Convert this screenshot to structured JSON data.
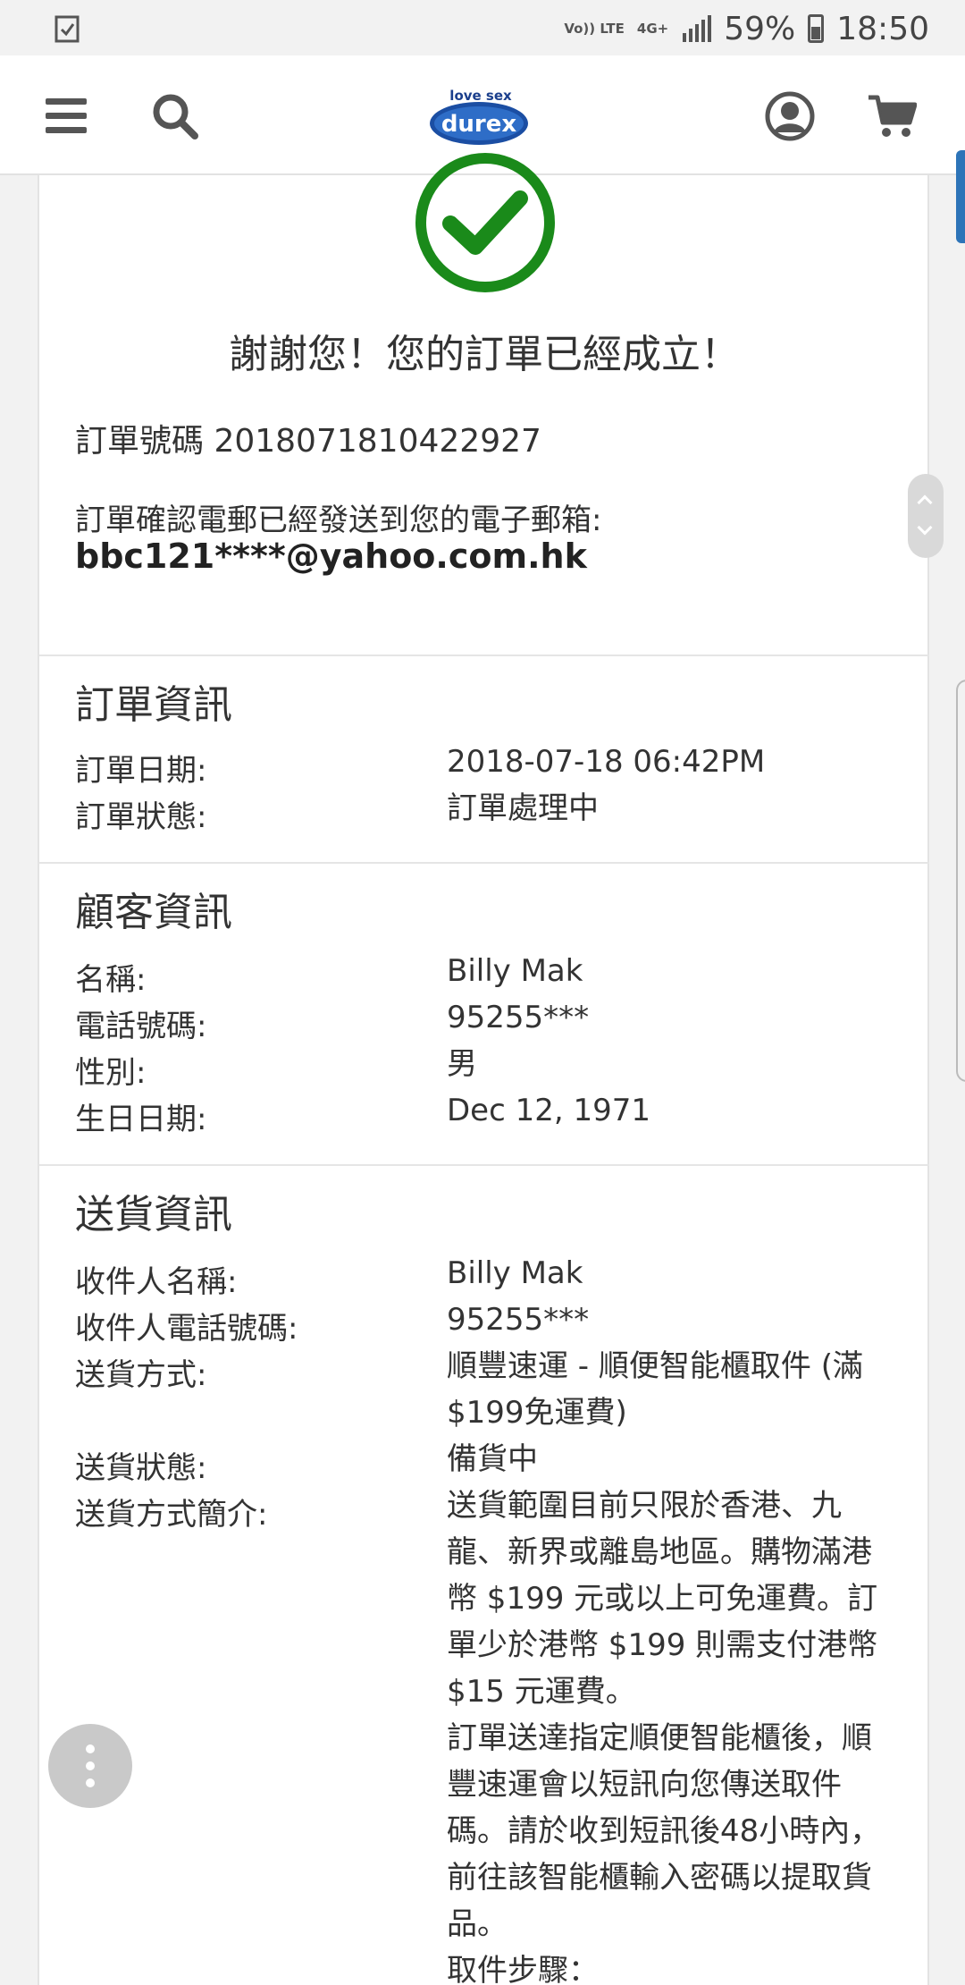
{
  "status_bar": {
    "left_icon": "clipboard-check-icon",
    "network": "Vo)) LTE",
    "network_type": "4G+",
    "battery": "59%",
    "time": "18:50"
  },
  "navbar": {
    "menu_icon": "hamburger-menu-icon",
    "search_icon": "search-icon",
    "logo_tagline": "love sex",
    "logo_brand": "durex",
    "account_icon": "user-account-icon",
    "cart_icon": "shopping-cart-icon"
  },
  "confirmation": {
    "icon": "check-circle-icon",
    "title": "謝謝您！您的訂單已經成立！",
    "order_number_text": "訂單號碼 2018071810422927",
    "email_sent_text": "訂單確認電郵已經發送到您的電子郵箱:",
    "email": "bbc121****@yahoo.com.hk"
  },
  "order_info": {
    "title": "訂單資訊",
    "rows": [
      {
        "label": "訂單日期:",
        "value": "2018-07-18 06:42PM"
      },
      {
        "label": "訂單狀態:",
        "value": "訂單處理中"
      }
    ]
  },
  "customer_info": {
    "title": "顧客資訊",
    "rows": [
      {
        "label": "名稱:",
        "value": "Billy Mak"
      },
      {
        "label": "電話號碼:",
        "value": "95255***"
      },
      {
        "label": "性別:",
        "value": "男"
      },
      {
        "label": "生日日期:",
        "value": "Dec 12, 1971"
      }
    ]
  },
  "delivery_info": {
    "title": "送貨資訊",
    "rows": [
      {
        "label": "收件人名稱:",
        "value": "Billy Mak"
      },
      {
        "label": "收件人電話號碼:",
        "value": "95255***"
      },
      {
        "label": "送貨方式:",
        "value": "順豐速運 - 順便智能櫃取件 (滿$199免運費)"
      },
      {
        "label": "送貨狀態:",
        "value": "備貨中"
      },
      {
        "label": "送貨方式簡介:",
        "value": "送貨範圍目前只限於香港、九龍、新界或離島地區。購物滿港幣 $199 元或以上可免運費。訂單少於港幣 $199 則需支付港幣 $15 元運費。"
      }
    ],
    "description_paragraph_2": "訂單送達指定順便智能櫃後，順豐速運會以短訊向您傳送取件碼。請於收到短訊後48小時內，前往該智能櫃輸入密碼以提取貨品。",
    "description_paragraph_3": "取件步驟："
  },
  "floating": {
    "more_button_icon": "more-vertical-icon",
    "scroll_icons": [
      "chevron-up-icon",
      "chevron-down-icon"
    ]
  },
  "colors": {
    "check_green": "#1a8a1a",
    "side_tab_blue": "#2d74b8",
    "text": "#333333"
  }
}
